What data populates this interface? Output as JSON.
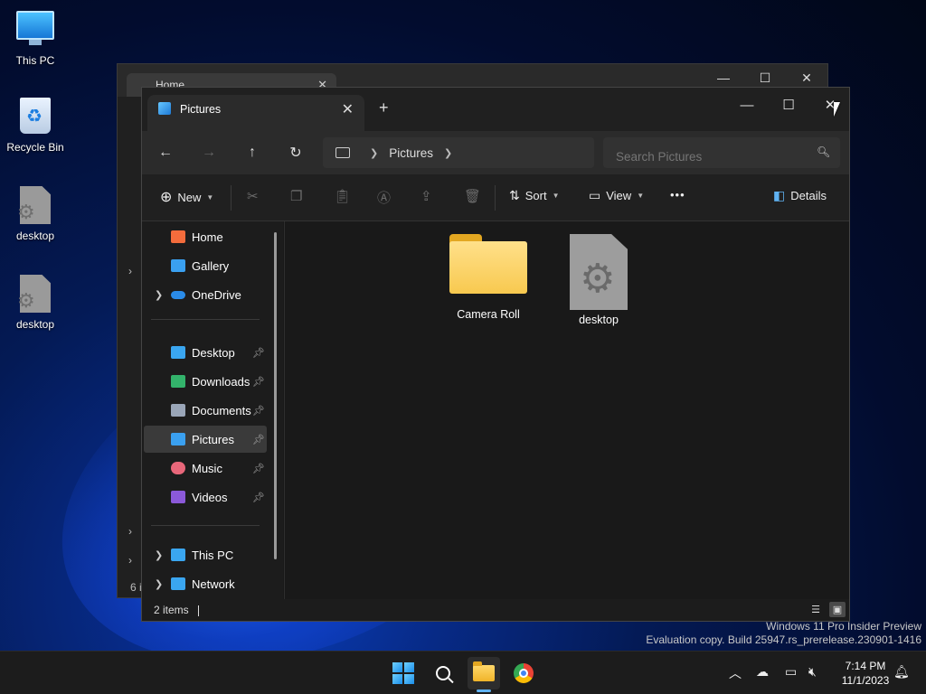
{
  "desktop": {
    "icons": [
      {
        "label": "This PC",
        "icon": "monitor-icon"
      },
      {
        "label": "Recycle Bin",
        "icon": "recycle-bin-icon"
      },
      {
        "label": "desktop",
        "icon": "settings-file-icon"
      },
      {
        "label": "desktop",
        "icon": "settings-file-icon"
      }
    ]
  },
  "back_window": {
    "tab_title": "Home",
    "item_count": "6 i"
  },
  "window": {
    "tab_title": "Pictures",
    "new_tab": "+",
    "controls": {
      "minimize": "—",
      "maximize": "☐",
      "close": "✕"
    },
    "breadcrumb": [
      "Pictures"
    ],
    "search_placeholder": "Search Pictures",
    "command_bar": {
      "new_label": "New",
      "sort_label": "Sort",
      "view_label": "View",
      "more_label": "•••",
      "details_label": "Details"
    },
    "sidebar": {
      "group1": [
        {
          "label": "Home",
          "icon": "home-icon",
          "color": "#f36c3c"
        },
        {
          "label": "Gallery",
          "icon": "gallery-icon",
          "color": "#3aa0f0"
        },
        {
          "label": "OneDrive",
          "icon": "cloud-icon",
          "color": "#2a8be8"
        }
      ],
      "group2": [
        {
          "label": "Desktop",
          "icon": "desktop-icon",
          "color": "#3aa6f0"
        },
        {
          "label": "Downloads",
          "icon": "download-icon",
          "color": "#33b36b"
        },
        {
          "label": "Documents",
          "icon": "document-icon",
          "color": "#9aa6b8"
        },
        {
          "label": "Pictures",
          "icon": "pictures-icon",
          "color": "#3aa0f0"
        },
        {
          "label": "Music",
          "icon": "music-icon",
          "color": "#e8677a"
        },
        {
          "label": "Videos",
          "icon": "videos-icon",
          "color": "#8b59d9"
        }
      ],
      "group3": [
        {
          "label": "This PC",
          "icon": "pc-icon",
          "color": "#3aa6f0"
        },
        {
          "label": "Network",
          "icon": "network-icon",
          "color": "#3aa6f0"
        }
      ]
    },
    "files": [
      {
        "name": "Camera Roll",
        "type": "folder"
      },
      {
        "name": "desktop",
        "type": "settings-file"
      }
    ],
    "status_text": "2 items"
  },
  "watermark": {
    "line1": "Windows 11 Pro Insider Preview",
    "line2": "Evaluation copy. Build 25947.rs_prerelease.230901-1416"
  },
  "taskbar": {
    "time": "7:14 PM",
    "date": "11/1/2023"
  }
}
